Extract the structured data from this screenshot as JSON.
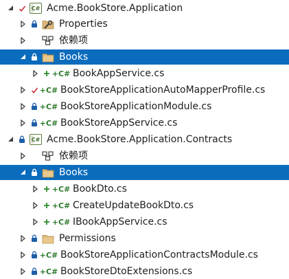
{
  "tree": {
    "rows": [
      {
        "label": "Acme.BookStore.Application",
        "icon": "project-icon",
        "icon_text": "C#",
        "expand": "expanded-arrow",
        "state": "checkmark",
        "indent": 0,
        "selected": false
      },
      {
        "label": "Properties",
        "icon": "wrench-folder-icon",
        "icon_text": "",
        "expand": "collapsed-arrow",
        "state": "lock",
        "indent": 1,
        "selected": false
      },
      {
        "label": "依赖项",
        "icon": "dependencies-icon",
        "icon_text": "",
        "expand": "collapsed-arrow",
        "state": "none",
        "indent": 1,
        "selected": false
      },
      {
        "label": "Books",
        "icon": "folder-icon",
        "icon_text": "",
        "expand": "expanded-arrow",
        "state": "lock",
        "indent": 1,
        "selected": true
      },
      {
        "label": "BookAppService.cs",
        "icon": "csharp-file-icon",
        "icon_text": "C#",
        "expand": "collapsed-arrow",
        "state": "plus",
        "indent": 2,
        "selected": false
      },
      {
        "label": "BookStoreApplicationAutoMapperProfile.cs",
        "icon": "csharp-file-icon",
        "icon_text": "C#",
        "expand": "collapsed-arrow",
        "state": "checkmark",
        "indent": 1,
        "selected": false
      },
      {
        "label": "BookStoreApplicationModule.cs",
        "icon": "csharp-file-icon",
        "icon_text": "C#",
        "expand": "collapsed-arrow",
        "state": "lock",
        "indent": 1,
        "selected": false
      },
      {
        "label": "BookStoreAppService.cs",
        "icon": "csharp-file-icon",
        "icon_text": "C#",
        "expand": "collapsed-arrow",
        "state": "lock",
        "indent": 1,
        "selected": false
      },
      {
        "label": "Acme.BookStore.Application.Contracts",
        "icon": "project-icon",
        "icon_text": "C#",
        "expand": "expanded-arrow",
        "state": "lock",
        "indent": 0,
        "selected": false
      },
      {
        "label": "依赖项",
        "icon": "dependencies-icon",
        "icon_text": "",
        "expand": "collapsed-arrow",
        "state": "none",
        "indent": 1,
        "selected": false
      },
      {
        "label": "Books",
        "icon": "folder-icon",
        "icon_text": "",
        "expand": "expanded-arrow",
        "state": "lock",
        "indent": 1,
        "selected": true
      },
      {
        "label": "BookDto.cs",
        "icon": "csharp-file-icon",
        "icon_text": "C#",
        "expand": "collapsed-arrow",
        "state": "plus",
        "indent": 2,
        "selected": false
      },
      {
        "label": "CreateUpdateBookDto.cs",
        "icon": "csharp-file-icon",
        "icon_text": "C#",
        "expand": "collapsed-arrow",
        "state": "plus",
        "indent": 2,
        "selected": false
      },
      {
        "label": "IBookAppService.cs",
        "icon": "csharp-file-icon",
        "icon_text": "C#",
        "expand": "collapsed-arrow",
        "state": "plus",
        "indent": 2,
        "selected": false
      },
      {
        "label": "Permissions",
        "icon": "folder-icon",
        "icon_text": "",
        "expand": "collapsed-arrow",
        "state": "lock",
        "indent": 1,
        "selected": false
      },
      {
        "label": "BookStoreApplicationContractsModule.cs",
        "icon": "csharp-file-icon",
        "icon_text": "C#",
        "expand": "collapsed-arrow",
        "state": "lock",
        "indent": 1,
        "selected": false
      },
      {
        "label": "BookStoreDtoExtensions.cs",
        "icon": "csharp-file-icon",
        "icon_text": "C#",
        "expand": "collapsed-arrow",
        "state": "lock",
        "indent": 1,
        "selected": false
      }
    ]
  },
  "colors": {
    "selected_background": "#0b6cbd",
    "selected_text": "#ffffff",
    "checkmark": "#c5303a",
    "lock": "#1f5faa",
    "plus": "#2b8a2b",
    "folder": "#dcb67a",
    "csharp": "#2f7a2f"
  }
}
